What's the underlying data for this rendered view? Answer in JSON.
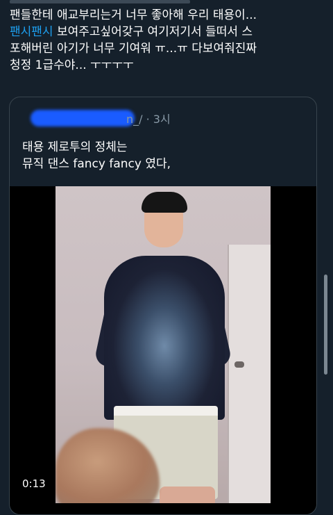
{
  "tweet": {
    "line1": "팬들한테 애교부리는거 너무 좋아해 우리 태용이...",
    "line2_highlight": "팬시팬시",
    "line2_rest": " 보여주고싶어갖구 여기저기서 들떠서 스",
    "line3": "포해버린 아기가 너무 기여워 ㅠ...ㅠ 다보여줘진짜",
    "line4": "청정 1급수야... ㅜㅜㅜㅜ",
    "highlight_color": "#1da1f2"
  },
  "quote": {
    "handle_time": "n_/ · 3시",
    "text_line1": "태용 제로투의 정체는",
    "text_line2": "뮤직 댄스 fancy fancy 였다,"
  },
  "video": {
    "duration": "0:13"
  },
  "colors": {
    "background": "#15202b",
    "border": "#38444d",
    "secondary_text": "#8899a6",
    "redaction": "#1a5cff"
  }
}
